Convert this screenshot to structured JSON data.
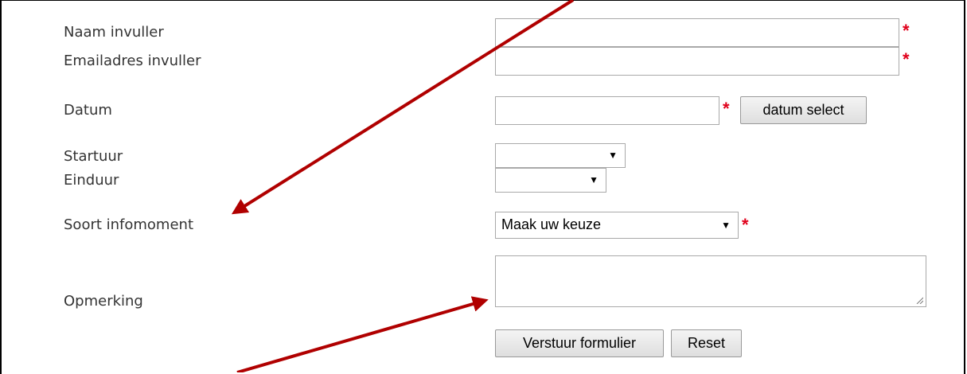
{
  "form": {
    "name_label": "Naam invuller",
    "email_label": "Emailadres invuller",
    "date_label": "Datum",
    "date_button": "datum select",
    "start_label": "Startuur",
    "end_label": "Einduur",
    "type_label": "Soort infomoment",
    "type_value": "Maak uw keuze",
    "remark_label": "Opmerking",
    "required_mark": "*",
    "submit_label": "Verstuur formulier",
    "reset_label": "Reset"
  },
  "colors": {
    "required": "#e0001b",
    "annotation_arrow": "#b00000"
  }
}
